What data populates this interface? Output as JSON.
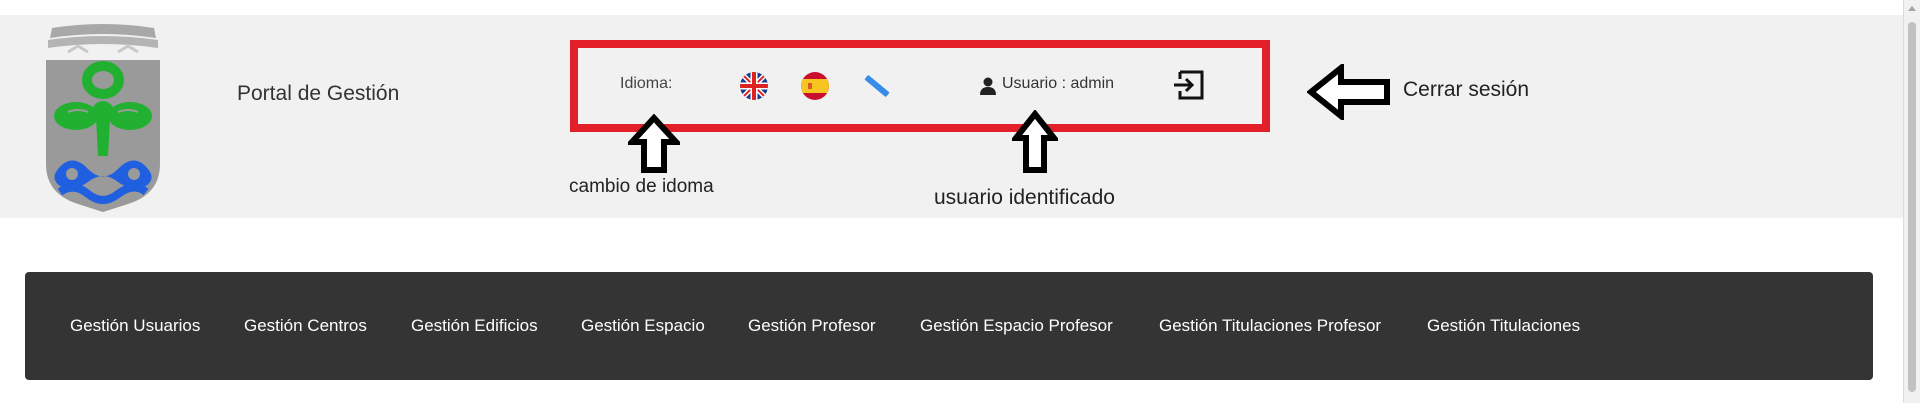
{
  "header": {
    "portal_title": "Portal de Gestión",
    "language_label": "Idioma:",
    "languages": [
      {
        "code": "en",
        "icon": "uk-flag-icon"
      },
      {
        "code": "es",
        "icon": "spain-flag-icon"
      },
      {
        "code": "gl",
        "icon": "galicia-flag-icon"
      }
    ],
    "user_label": "Usuario : admin",
    "logout_icon": "logout-icon"
  },
  "annotations": {
    "logout": "Cerrar sesión",
    "language_change": "cambio de idoma",
    "identified_user": "usuario identificado",
    "highlight_color": "#e3202a"
  },
  "nav": {
    "items": [
      "Gestión Usuarios",
      "Gestión Centros",
      "Gestión Edificios",
      "Gestión Espacio",
      "Gestión Profesor",
      "Gestión Espacio Profesor",
      "Gestión Titulaciones Profesor",
      "Gestión Titulaciones"
    ]
  },
  "colors": {
    "navbar_bg": "#343434",
    "header_bg": "#f1f1f1",
    "logo_green": "#22b030",
    "logo_blue": "#1f5fe0"
  }
}
